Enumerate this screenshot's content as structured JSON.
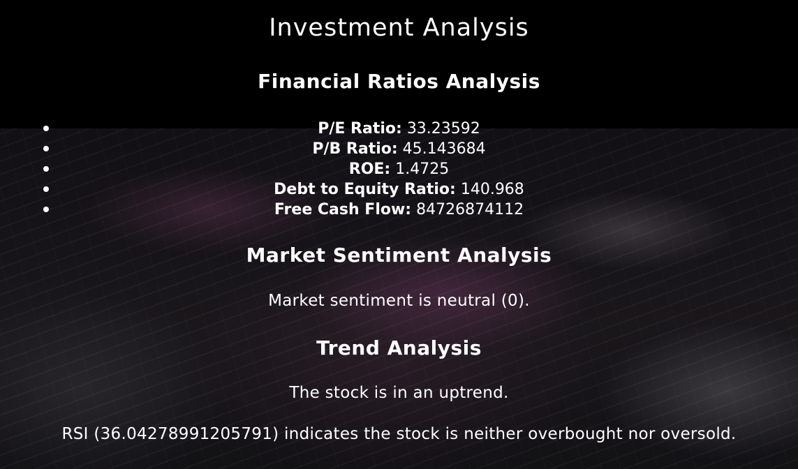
{
  "page": {
    "title": "Investment Analysis"
  },
  "financial_ratios": {
    "heading": "Financial Ratios Analysis",
    "items": [
      {
        "label": "P/E Ratio:",
        "value": "33.23592"
      },
      {
        "label": "P/B Ratio:",
        "value": "45.143684"
      },
      {
        "label": "ROE:",
        "value": "1.4725"
      },
      {
        "label": "Debt to Equity Ratio:",
        "value": "140.968"
      },
      {
        "label": "Free Cash Flow:",
        "value": "84726874112"
      }
    ]
  },
  "market_sentiment": {
    "heading": "Market Sentiment Analysis",
    "text": "Market sentiment is neutral (0)."
  },
  "trend": {
    "heading": "Trend Analysis",
    "text": "The stock is in an uptrend.",
    "rsi_text": "RSI (36.04278991205791) indicates the stock is neither overbought nor oversold."
  },
  "colors": {
    "text": "#ffffff",
    "background": "#000000",
    "accent_streak": "#9a4a80"
  }
}
